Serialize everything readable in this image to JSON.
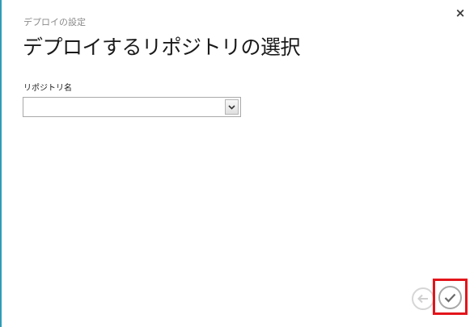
{
  "dialog": {
    "subtitle": "デプロイの設定",
    "title": "デプロイするリポジトリの選択",
    "close_icon": "close-icon",
    "close_glyph": "×"
  },
  "form": {
    "repository_label": "リポジトリ名",
    "repository_value": ""
  },
  "footer": {
    "back_icon": "arrow-left-icon",
    "next_icon": "checkmark-icon"
  },
  "colors": {
    "accent_border": "#2f9bb8",
    "highlight": "#e3141b"
  }
}
